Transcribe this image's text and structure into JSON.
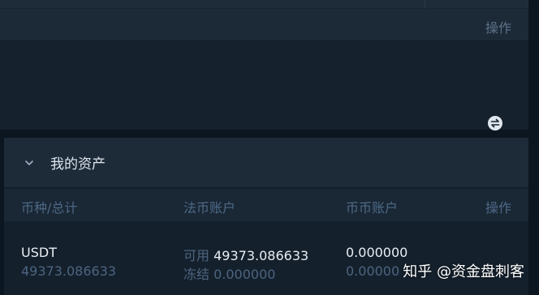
{
  "top_table": {
    "action_header": "操作"
  },
  "assets": {
    "title": "我的资产",
    "columns": {
      "currency": "币种/总计",
      "fiat_account": "法币账户",
      "coin_account": "币币账户",
      "action": "操作"
    },
    "rows": [
      {
        "currency": "USDT",
        "total": "49373.086633",
        "fiat_available_label": "可用",
        "fiat_available": "49373.086633",
        "fiat_frozen_label": "冻结",
        "fiat_frozen": "0.000000",
        "coin_available": "0.000000",
        "coin_frozen": "0.00000"
      }
    ]
  },
  "watermark": "知乎 @资金盘刺客",
  "colors": {
    "page_bg": "#0c1620",
    "panel_bg": "#15212d",
    "header_bg": "#1d2b39",
    "muted_text": "#4e6a86",
    "bright_text": "#e9eef4"
  },
  "icons": {
    "collapse": "chevron-down-icon",
    "row_action": "transfer-icon"
  }
}
